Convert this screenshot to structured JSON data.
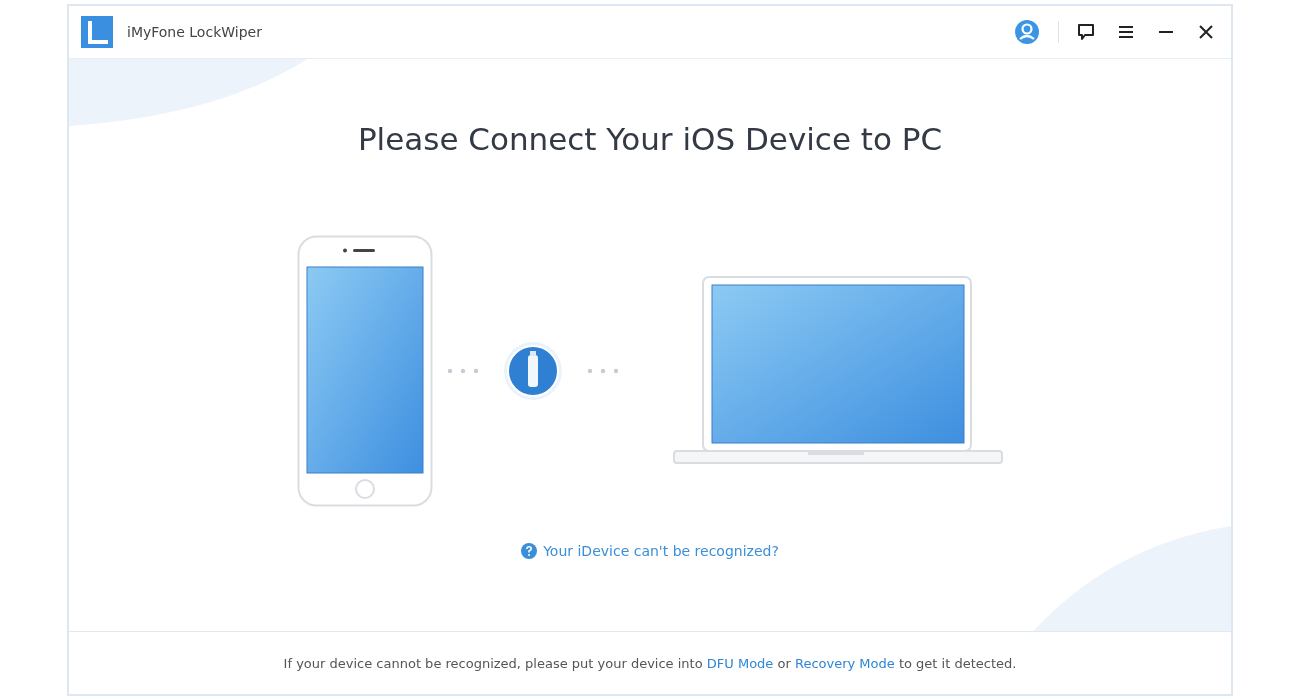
{
  "window": {
    "title": "iMyFone LockWiper"
  },
  "heading": "Please Connect Your iOS Device to PC",
  "help_link": "Your iDevice can't be recognized?",
  "footer": [
    {
      "kind": "text",
      "text": "If your device cannot be recognized, please put your device into "
    },
    {
      "kind": "link",
      "text": "DFU Mode"
    },
    {
      "kind": "text",
      "text": " or "
    },
    {
      "kind": "link",
      "text": "Recovery Mode"
    },
    {
      "kind": "text",
      "text": " to get it detected."
    }
  ]
}
